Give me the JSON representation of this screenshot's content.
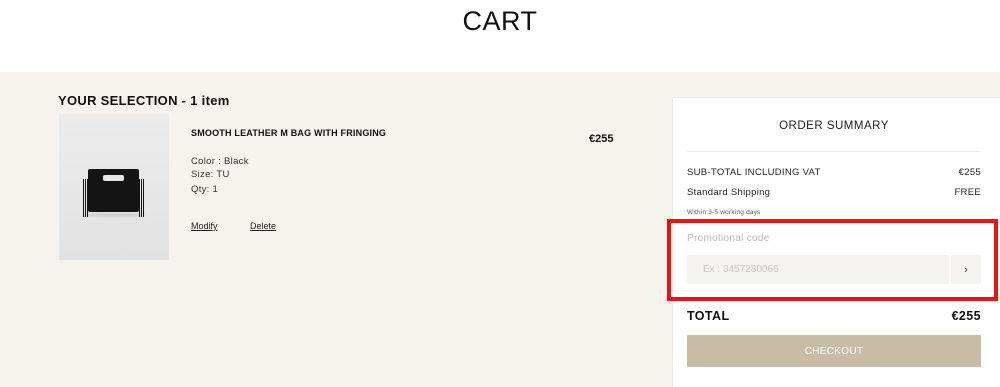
{
  "header": {
    "title": "CART"
  },
  "selection": {
    "title": "YOUR SELECTION - 1 item",
    "product": {
      "name": "SMOOTH LEATHER M BAG WITH FRINGING",
      "color": "Color : Black",
      "size": "Size: TU",
      "qty": "Qty: 1",
      "price": "€255",
      "modify_label": "Modify",
      "delete_label": "Delete"
    }
  },
  "summary": {
    "title": "ORDER SUMMARY",
    "subtotal_label": "SUB-TOTAL INCLUDING VAT",
    "subtotal_value": "€255",
    "shipping_label": "Standard Shipping",
    "shipping_value": "FREE",
    "shipping_note": "Within 3-5 working days",
    "promo_label": "Promotional code",
    "promo_placeholder": "Ex : 3457280066",
    "promo_submit_icon": "chevron-right-icon",
    "total_label": "TOTAL",
    "total_value": "€255",
    "checkout_label": "CHECKOUT"
  },
  "colors": {
    "background": "#f6f3ee",
    "checkout": "#c9bca5",
    "highlight": "#ee1111"
  }
}
